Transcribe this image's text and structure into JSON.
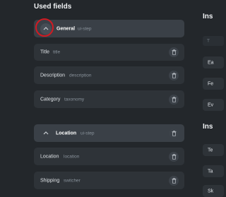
{
  "used_fields": {
    "title": "Used fields",
    "groups": [
      {
        "label": "General",
        "type": "ui-step",
        "fields": [
          {
            "label": "Title",
            "type": "title"
          },
          {
            "label": "Description",
            "type": "description"
          },
          {
            "label": "Category",
            "type": "taxonomy"
          }
        ]
      },
      {
        "label": "Location",
        "type": "ui-step",
        "fields": [
          {
            "label": "Location",
            "type": "location"
          },
          {
            "label": "Shipping",
            "type": "switcher"
          }
        ]
      }
    ]
  },
  "side_panel": {
    "title_1": "Ins",
    "search_placeholder": "T",
    "items_1": [
      "Ea",
      "Fe",
      "Ev"
    ],
    "title_2": "Ins",
    "items_2": [
      "Te",
      "Ta",
      "Sk"
    ]
  },
  "colors": {
    "background": "#23272b",
    "field_row": "#2e3338",
    "step_row": "#3a4047",
    "highlight": "#d11a22"
  },
  "icons": {
    "chevron": "chevron-up-icon",
    "trash": "trash-icon"
  }
}
